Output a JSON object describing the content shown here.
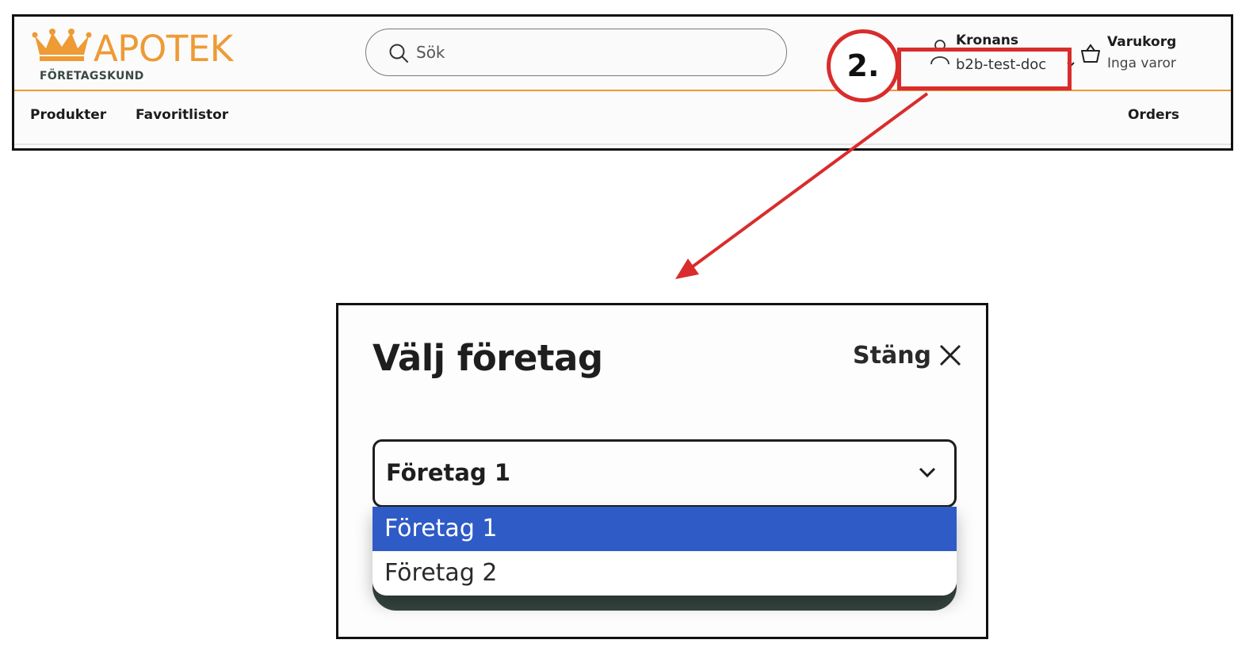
{
  "header": {
    "logo": {
      "brand": "APOTEK",
      "subtitle": "FÖRETAGSKUND"
    },
    "search": {
      "placeholder": "Sök"
    },
    "account": {
      "label": "Kronans",
      "value": "b2b-test-doc"
    },
    "cart": {
      "label": "Varukorg",
      "status": "Inga varor"
    },
    "nav": {
      "products": "Produkter",
      "favorites": "Favoritlistor",
      "orders": "Orders"
    }
  },
  "annotation": {
    "step": "2.",
    "color": "#d92c2c"
  },
  "modal": {
    "title": "Välj företag",
    "close_label": "Stäng",
    "select": {
      "value": "Företag 1",
      "options": [
        "Företag 1",
        "Företag 2"
      ],
      "highlighted": "Företag 1"
    }
  },
  "colors": {
    "brand_orange": "#ee9a35",
    "highlight_blue": "#2f5bc7",
    "dark_green": "#374640"
  }
}
